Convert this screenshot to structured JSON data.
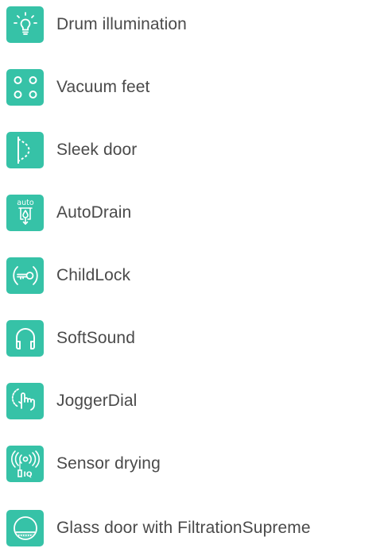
{
  "colors": {
    "icon_background": "#36c2a7",
    "icon_foreground": "#ffffff",
    "label_text": "#4a4a4a"
  },
  "features": [
    {
      "icon": "light-bulb-icon",
      "label": "Drum illumination"
    },
    {
      "icon": "vacuum-feet-icon",
      "label": "Vacuum feet"
    },
    {
      "icon": "sleek-door-icon",
      "label": "Sleek door"
    },
    {
      "icon": "auto-drain-icon",
      "icon_text": "auto",
      "label": "AutoDrain"
    },
    {
      "icon": "child-lock-key-icon",
      "label": "ChildLock"
    },
    {
      "icon": "headphones-icon",
      "label": "SoftSound"
    },
    {
      "icon": "jogger-dial-hand-icon",
      "label": "JoggerDial"
    },
    {
      "icon": "sensor-signal-icon",
      "icon_text": "IQ",
      "label": "Sensor drying"
    },
    {
      "icon": "glass-door-filter-icon",
      "label": "Glass door with FiltrationSupreme"
    }
  ]
}
